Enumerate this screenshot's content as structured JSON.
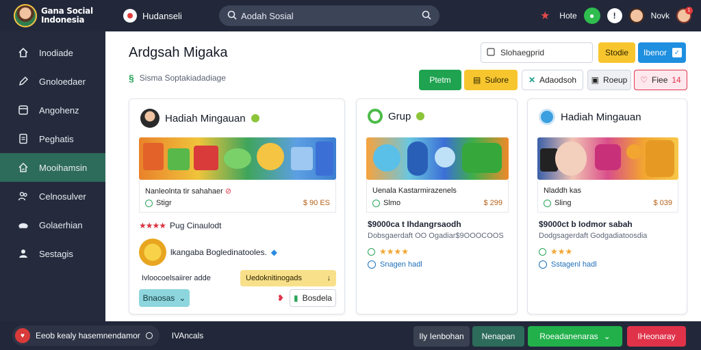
{
  "topbar": {
    "brand_line1": "Gana Social",
    "brand_line2": "Indonesia",
    "home_label": "Hudanseli",
    "search_placeholder": "Aodah Sosial",
    "right_item1": "Hote",
    "right_item2": "Novk",
    "notif_count": "1"
  },
  "sidebar": {
    "items": [
      {
        "label": "Inodiade",
        "icon": "home-icon"
      },
      {
        "label": "Gnoloedaer",
        "icon": "pen-icon"
      },
      {
        "label": "Angohenz",
        "icon": "panel-icon"
      },
      {
        "label": "Peghatis",
        "icon": "document-icon"
      },
      {
        "label": "Mooihamsin",
        "icon": "chart-home-icon"
      },
      {
        "label": "Celnosulver",
        "icon": "group-icon"
      },
      {
        "label": "Golaerhian",
        "icon": "shield-icon"
      },
      {
        "label": "Sestagis",
        "icon": "settings-icon"
      }
    ]
  },
  "main": {
    "title": "Ardgsah Migaka",
    "subtitle": "Sisma Soptakiadadiage",
    "search_value": "Slohaegprid",
    "btn_yellow1": "Stodie",
    "btn_blue": "Ibenor",
    "btn_green": "Ptetm",
    "btn_yellow2": "Sulore",
    "btn_outline1": "Adaodsoh",
    "btn_outline2": "Roeup",
    "btn_red": "Fiee",
    "btn_red_badge": "14"
  },
  "cards": [
    {
      "title": "Hadiah Mingauan",
      "sub_title": "Nanleolnta tir sahahaer",
      "sub_status": "Stigr",
      "sub_value": "$ 90 ES",
      "rating_label": "Pug Cinaulodt",
      "coin_text": "lkangaba Bogledinatooles.",
      "select_text": "Ivloocoelsaiirer adde",
      "select_right": "Uedoknitinogads",
      "btn_teal": "Bnaosas",
      "btn_outline": "Bosdela"
    },
    {
      "title": "Grup",
      "sub_title": "Uenala Kastarmirazenels",
      "sub_status": "Slmo",
      "sub_value": "$ 299",
      "price_line": "$9000ca t Ihdangrsaodh",
      "desc_line": "Dobsgaerdaft OO Ogadiar$9OOOCOOS",
      "link_text": "Snagen hadl"
    },
    {
      "title": "Hadiah Mingauan",
      "sub_title": "Nladdh kas",
      "sub_status": "Sling",
      "sub_value": "$ 039",
      "price_line": "$9000ct b Iodmor sabah",
      "desc_line": "Dodgsagerdaft Godgadiatoosdia",
      "link_text": "Sstagenl hadl"
    }
  ],
  "bottom": {
    "pill_text": "Eeob kealy hasemnendamor",
    "label": "IVAncals",
    "btn1": "Ily Ienbohan",
    "btn2": "Nenapan",
    "btn3": "Roeadanenaras",
    "btn4": "IHeonaray"
  },
  "colors": {
    "topbar": "#22283a",
    "sidebar_active": "#2d6b5a",
    "green": "#1fa350",
    "yellow": "#f7c62f",
    "blue": "#1f8fe0",
    "red": "#e0334a"
  }
}
